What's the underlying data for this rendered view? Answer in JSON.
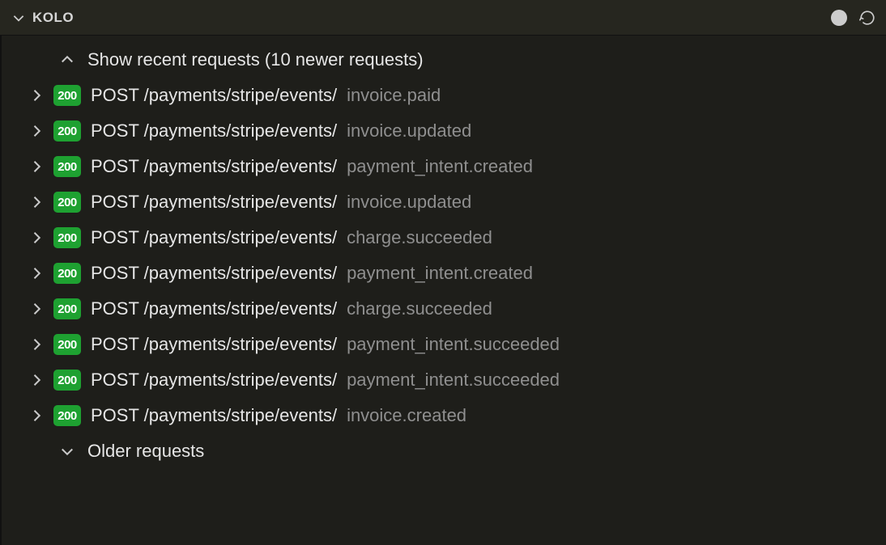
{
  "header": {
    "title": "KOLO"
  },
  "recent": {
    "label": "Show recent requests (10 newer requests)"
  },
  "older": {
    "label": "Older requests"
  },
  "requests": [
    {
      "status": "200",
      "method": "POST",
      "path": "/payments/stripe/events/",
      "event": "invoice.paid"
    },
    {
      "status": "200",
      "method": "POST",
      "path": "/payments/stripe/events/",
      "event": "invoice.updated"
    },
    {
      "status": "200",
      "method": "POST",
      "path": "/payments/stripe/events/",
      "event": "payment_intent.created"
    },
    {
      "status": "200",
      "method": "POST",
      "path": "/payments/stripe/events/",
      "event": "invoice.updated"
    },
    {
      "status": "200",
      "method": "POST",
      "path": "/payments/stripe/events/",
      "event": "charge.succeeded"
    },
    {
      "status": "200",
      "method": "POST",
      "path": "/payments/stripe/events/",
      "event": "payment_intent.created"
    },
    {
      "status": "200",
      "method": "POST",
      "path": "/payments/stripe/events/",
      "event": "charge.succeeded"
    },
    {
      "status": "200",
      "method": "POST",
      "path": "/payments/stripe/events/",
      "event": "payment_intent.succeeded"
    },
    {
      "status": "200",
      "method": "POST",
      "path": "/payments/stripe/events/",
      "event": "payment_intent.succeeded"
    },
    {
      "status": "200",
      "method": "POST",
      "path": "/payments/stripe/events/",
      "event": "invoice.created"
    }
  ]
}
